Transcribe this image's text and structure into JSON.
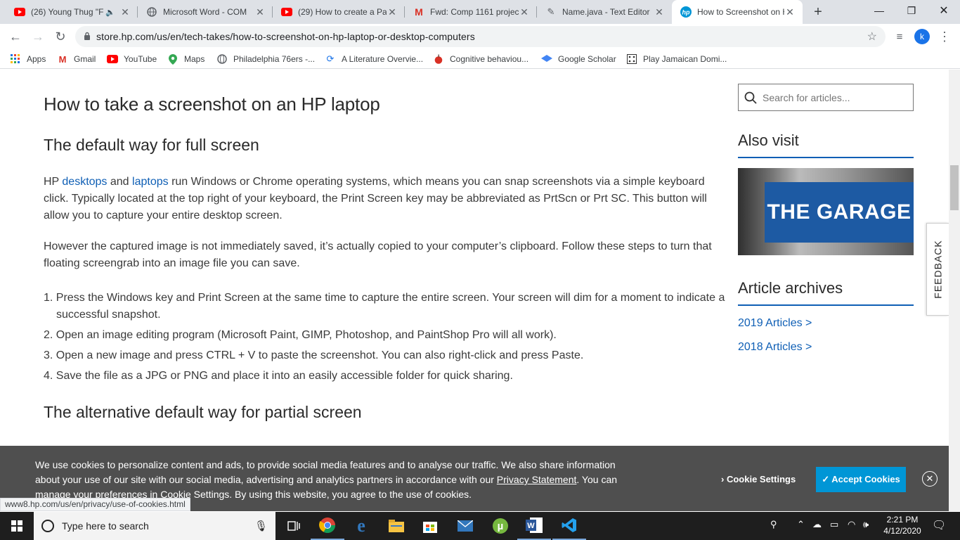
{
  "tabs": [
    {
      "title": "(26) Young Thug \"F",
      "icon": "youtube-icon"
    },
    {
      "title": "Microsoft Word - COM",
      "icon": "globe-icon"
    },
    {
      "title": "(29) How to create a Pa",
      "icon": "youtube-icon"
    },
    {
      "title": "Fwd: Comp 1161 projec",
      "icon": "gmail-icon"
    },
    {
      "title": "Name.java - Text Editor",
      "icon": "text-editor-icon"
    },
    {
      "title": "How to Screenshot on H",
      "icon": "hp-icon"
    }
  ],
  "address_bar": {
    "url": "store.hp.com/us/en/tech-takes/how-to-screenshot-on-hp-laptop-or-desktop-computers"
  },
  "profile_initial": "k",
  "bookmarks": [
    {
      "label": "Apps",
      "icon": "apps-grid-icon"
    },
    {
      "label": "Gmail",
      "icon": "gmail-icon"
    },
    {
      "label": "YouTube",
      "icon": "youtube-icon"
    },
    {
      "label": "Maps",
      "icon": "maps-icon"
    },
    {
      "label": "Philadelphia 76ers -...",
      "icon": "globe-icon"
    },
    {
      "label": "A Literature Overvie...",
      "icon": "sync-icon"
    },
    {
      "label": "Cognitive behaviou...",
      "icon": "apple-icon"
    },
    {
      "label": "Google Scholar",
      "icon": "scholar-icon"
    },
    {
      "label": "Play Jamaican Domi...",
      "icon": "dominoes-icon"
    }
  ],
  "article": {
    "h2": "How to take a screenshot on an HP laptop",
    "h3_full": "The default way for full screen",
    "p1": {
      "prefix": "HP ",
      "link1": "desktops",
      "mid": " and ",
      "link2": "laptops",
      "rest": " run Windows or Chrome operating systems, which means you can snap screenshots via a simple keyboard click. Typically located at the top right of your keyboard, the Print Screen key may be abbreviated as PrtScn or Prt SC. This button will allow you to capture your entire desktop screen."
    },
    "p2": "However the captured image is not immediately saved, it’s actually copied to your computer’s clipboard. Follow these steps to turn that floating screengrab into an image file you can save.",
    "steps": [
      "1. Press the Windows key and Print Screen at the same time to capture the entire screen. Your screen will dim for a moment to indicate a successful snapshot.",
      "2. Open an image editing program (Microsoft Paint, GIMP, Photoshop, and PaintShop Pro will all work).",
      "3. Open a new image and press CTRL + V to paste the screenshot. You can also right-click and press Paste.",
      "4. Save the file as a JPG or PNG and place it into an easily accessible folder for quick sharing."
    ],
    "h3_partial": "The alternative default way for partial screen"
  },
  "sidebar": {
    "search_placeholder": "Search for articles...",
    "also_visit": "Also visit",
    "garage_text": "THE GARAGE",
    "archives_title": "Article archives",
    "archives": [
      "2019 Articles >",
      "2018 Articles >"
    ],
    "feedback": "FEEDBACK"
  },
  "cookie": {
    "text_before": "We use cookies to personalize content and ads, to provide social media features and to analyse our traffic. We also share information about your use of our site with our social media, advertising and analytics partners in accordance with our ",
    "link": "Privacy Statement",
    "text_after": ". You can manage your preferences in Cookie Settings. By using this website, you agree to the use of cookies.",
    "settings": "Cookie Settings",
    "accept": "✓ Accept Cookies"
  },
  "status_url": "www8.hp.com/us/en/privacy/use-of-cookies.html",
  "taskbar": {
    "search_placeholder": "Type here to search",
    "time": "2:21 PM",
    "date": "4/12/2020"
  },
  "colors": {
    "hp_blue": "#0f5fb5",
    "accept_blue": "#0096d6",
    "cookie_bg": "#4f4f4f"
  }
}
